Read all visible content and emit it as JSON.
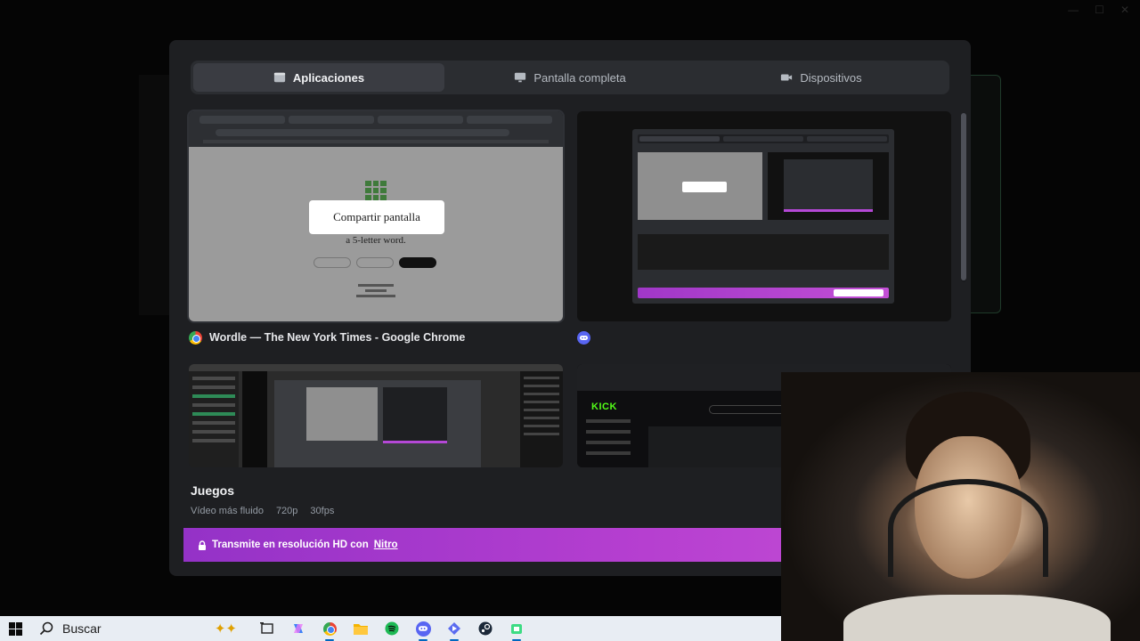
{
  "tabs": [
    {
      "label": "Aplicaciones",
      "icon": "window-icon",
      "active": true
    },
    {
      "label": "Pantalla completa",
      "icon": "monitor-icon",
      "active": false
    },
    {
      "label": "Dispositivos",
      "icon": "camera-icon",
      "active": false
    }
  ],
  "sources": [
    {
      "label": "Wordle — The New York Times - Google Chrome",
      "icon": "chrome-icon",
      "overlay": "Compartir pantalla",
      "text": "a 5-letter word."
    },
    {
      "label": "",
      "icon": "discord-icon"
    },
    {
      "label": "",
      "icon": ""
    },
    {
      "label": "",
      "icon": "",
      "logo": "KICK"
    }
  ],
  "quality": {
    "title": "Juegos",
    "desc": "Vídeo más fluido",
    "resolution": "720p",
    "fps": "30fps"
  },
  "nitro": {
    "text": "Transmite en resolución HD con",
    "link": "Nitro"
  },
  "taskbar": {
    "search_placeholder": "Buscar"
  },
  "colors": {
    "accent": "#b63fd0",
    "modal_bg": "#1e1f22",
    "taskbar_bg": "#e8edf3"
  }
}
